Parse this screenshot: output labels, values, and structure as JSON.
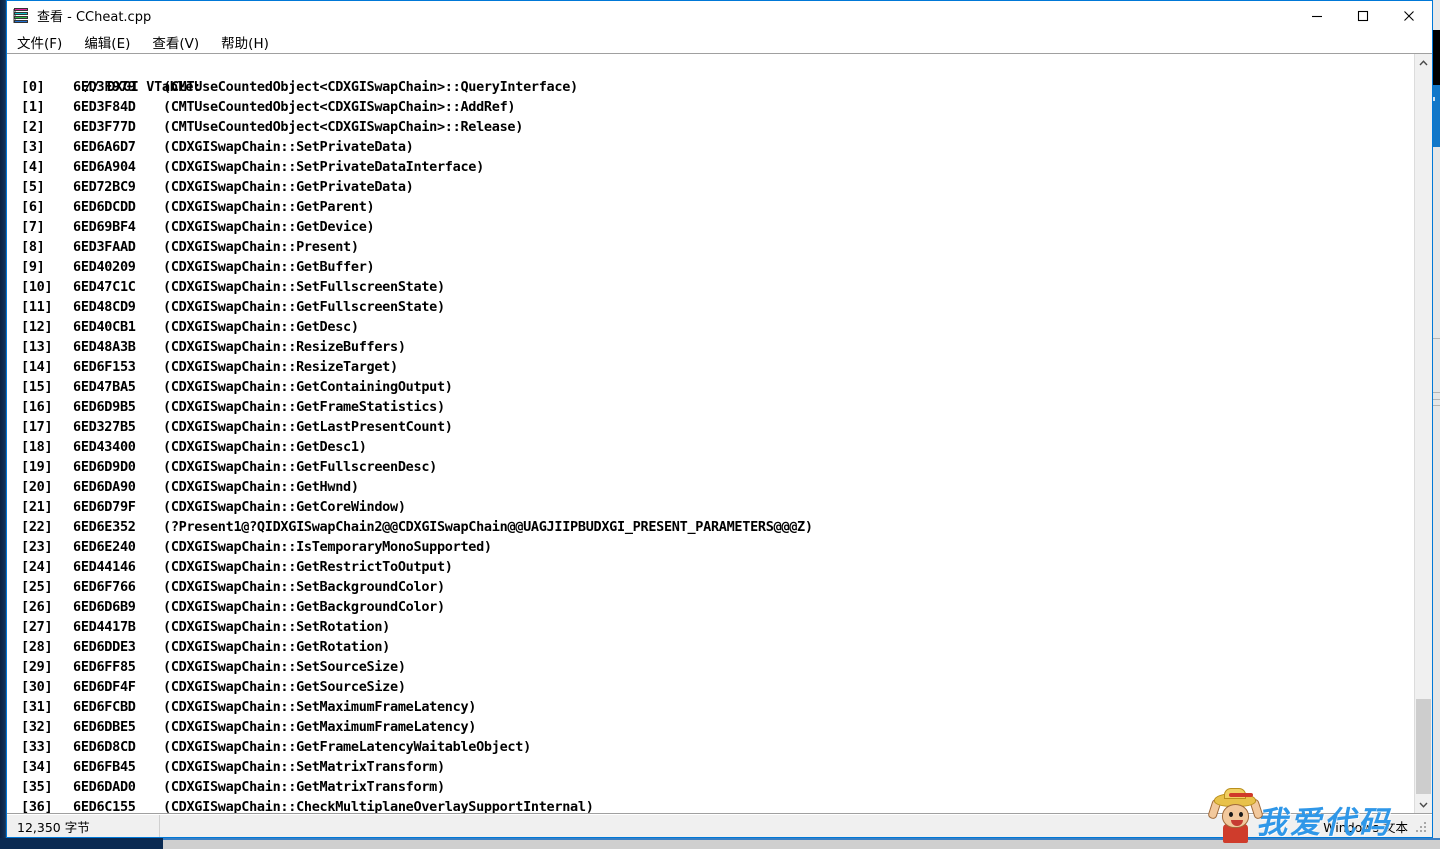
{
  "window": {
    "title": "查看 - CCheat.cpp",
    "icon": "book-stack-icon",
    "controls": {
      "minimize": "minimize-icon",
      "maximize": "maximize-icon",
      "close": "close-icon"
    }
  },
  "menu": {
    "items": [
      {
        "label": "文件(F)"
      },
      {
        "label": "编辑(E)"
      },
      {
        "label": "查看(V)"
      },
      {
        "label": "帮助(H)"
      }
    ]
  },
  "editor": {
    "header_comment": "// DXGI VTable:",
    "rows": [
      {
        "index": "[0]",
        "address": "6ED3F979",
        "symbol": "(CMTUseCountedObject<CDXGISwapChain>::QueryInterface)"
      },
      {
        "index": "[1]",
        "address": "6ED3F84D",
        "symbol": "(CMTUseCountedObject<CDXGISwapChain>::AddRef)"
      },
      {
        "index": "[2]",
        "address": "6ED3F77D",
        "symbol": "(CMTUseCountedObject<CDXGISwapChain>::Release)"
      },
      {
        "index": "[3]",
        "address": "6ED6A6D7",
        "symbol": "(CDXGISwapChain::SetPrivateData)"
      },
      {
        "index": "[4]",
        "address": "6ED6A904",
        "symbol": "(CDXGISwapChain::SetPrivateDataInterface)"
      },
      {
        "index": "[5]",
        "address": "6ED72BC9",
        "symbol": "(CDXGISwapChain::GetPrivateData)"
      },
      {
        "index": "[6]",
        "address": "6ED6DCDD",
        "symbol": "(CDXGISwapChain::GetParent)"
      },
      {
        "index": "[7]",
        "address": "6ED69BF4",
        "symbol": "(CDXGISwapChain::GetDevice)"
      },
      {
        "index": "[8]",
        "address": "6ED3FAAD",
        "symbol": "(CDXGISwapChain::Present)"
      },
      {
        "index": "[9]",
        "address": "6ED40209",
        "symbol": "(CDXGISwapChain::GetBuffer)"
      },
      {
        "index": "[10]",
        "address": "6ED47C1C",
        "symbol": "(CDXGISwapChain::SetFullscreenState)"
      },
      {
        "index": "[11]",
        "address": "6ED48CD9",
        "symbol": "(CDXGISwapChain::GetFullscreenState)"
      },
      {
        "index": "[12]",
        "address": "6ED40CB1",
        "symbol": "(CDXGISwapChain::GetDesc)"
      },
      {
        "index": "[13]",
        "address": "6ED48A3B",
        "symbol": "(CDXGISwapChain::ResizeBuffers)"
      },
      {
        "index": "[14]",
        "address": "6ED6F153",
        "symbol": "(CDXGISwapChain::ResizeTarget)"
      },
      {
        "index": "[15]",
        "address": "6ED47BA5",
        "symbol": "(CDXGISwapChain::GetContainingOutput)"
      },
      {
        "index": "[16]",
        "address": "6ED6D9B5",
        "symbol": "(CDXGISwapChain::GetFrameStatistics)"
      },
      {
        "index": "[17]",
        "address": "6ED327B5",
        "symbol": "(CDXGISwapChain::GetLastPresentCount)"
      },
      {
        "index": "[18]",
        "address": "6ED43400",
        "symbol": "(CDXGISwapChain::GetDesc1)"
      },
      {
        "index": "[19]",
        "address": "6ED6D9D0",
        "symbol": "(CDXGISwapChain::GetFullscreenDesc)"
      },
      {
        "index": "[20]",
        "address": "6ED6DA90",
        "symbol": "(CDXGISwapChain::GetHwnd)"
      },
      {
        "index": "[21]",
        "address": "6ED6D79F",
        "symbol": "(CDXGISwapChain::GetCoreWindow)"
      },
      {
        "index": "[22]",
        "address": "6ED6E352",
        "symbol": "(?Present1@?QIDXGISwapChain2@@CDXGISwapChain@@UAGJIIPBUDXGI_PRESENT_PARAMETERS@@@Z)"
      },
      {
        "index": "[23]",
        "address": "6ED6E240",
        "symbol": "(CDXGISwapChain::IsTemporaryMonoSupported)"
      },
      {
        "index": "[24]",
        "address": "6ED44146",
        "symbol": "(CDXGISwapChain::GetRestrictToOutput)"
      },
      {
        "index": "[25]",
        "address": "6ED6F766",
        "symbol": "(CDXGISwapChain::SetBackgroundColor)"
      },
      {
        "index": "[26]",
        "address": "6ED6D6B9",
        "symbol": "(CDXGISwapChain::GetBackgroundColor)"
      },
      {
        "index": "[27]",
        "address": "6ED4417B",
        "symbol": "(CDXGISwapChain::SetRotation)"
      },
      {
        "index": "[28]",
        "address": "6ED6DDE3",
        "symbol": "(CDXGISwapChain::GetRotation)"
      },
      {
        "index": "[29]",
        "address": "6ED6FF85",
        "symbol": "(CDXGISwapChain::SetSourceSize)"
      },
      {
        "index": "[30]",
        "address": "6ED6DF4F",
        "symbol": "(CDXGISwapChain::GetSourceSize)"
      },
      {
        "index": "[31]",
        "address": "6ED6FCBD",
        "symbol": "(CDXGISwapChain::SetMaximumFrameLatency)"
      },
      {
        "index": "[32]",
        "address": "6ED6DBE5",
        "symbol": "(CDXGISwapChain::GetMaximumFrameLatency)"
      },
      {
        "index": "[33]",
        "address": "6ED6D8CD",
        "symbol": "(CDXGISwapChain::GetFrameLatencyWaitableObject)"
      },
      {
        "index": "[34]",
        "address": "6ED6FB45",
        "symbol": "(CDXGISwapChain::SetMatrixTransform)"
      },
      {
        "index": "[35]",
        "address": "6ED6DAD0",
        "symbol": "(CDXGISwapChain::GetMatrixTransform)"
      },
      {
        "index": "[36]",
        "address": "6ED6C155",
        "symbol": "(CDXGISwapChain::CheckMultiplaneOverlaySupportInternal)"
      }
    ]
  },
  "statusbar": {
    "size_label": "12,350 字节",
    "encoding_label": "Windows 文本"
  },
  "watermark": {
    "text": "我爱代码"
  },
  "colors": {
    "accent": "#0078d7",
    "window_bg": "#f0f0f0",
    "editor_bg": "#ffffff",
    "text": "#000000",
    "watermark_blue": "#2f97e8"
  }
}
